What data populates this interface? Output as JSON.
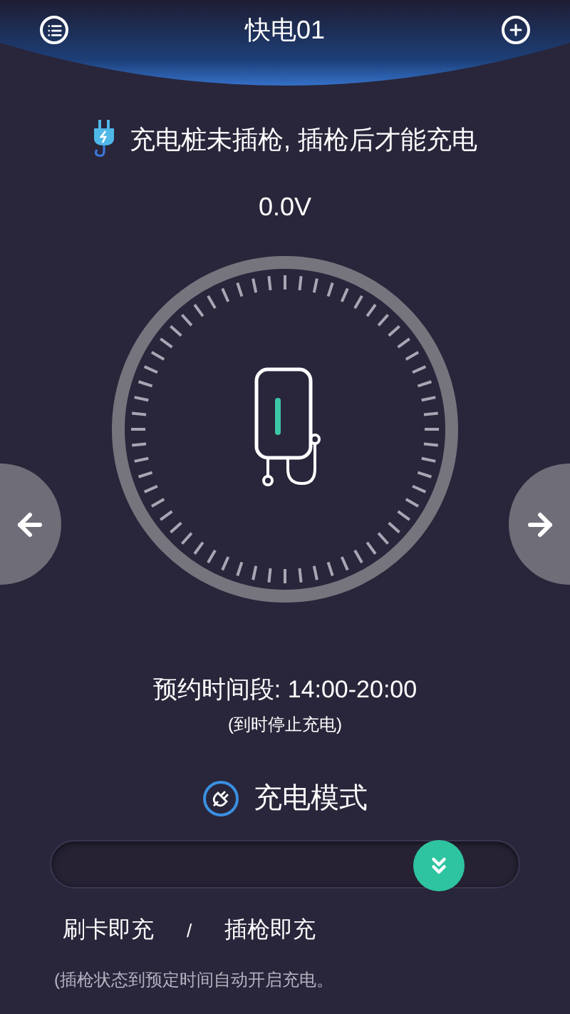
{
  "header": {
    "title": "快电01"
  },
  "status": {
    "message": "充电桩未插枪, 插枪后才能充电"
  },
  "voltage": "0.0V",
  "schedule": {
    "label": "预约时间段: 14:00-20:00",
    "note": "(到时停止充电)"
  },
  "charge_mode": {
    "title": "充电模式",
    "slider": {
      "level": 0.83
    },
    "options": [
      {
        "label": "刷卡即充"
      },
      {
        "label": "插枪即充"
      }
    ],
    "separator": "/",
    "note": "(插枪状态到预定时间自动开启充电。"
  }
}
